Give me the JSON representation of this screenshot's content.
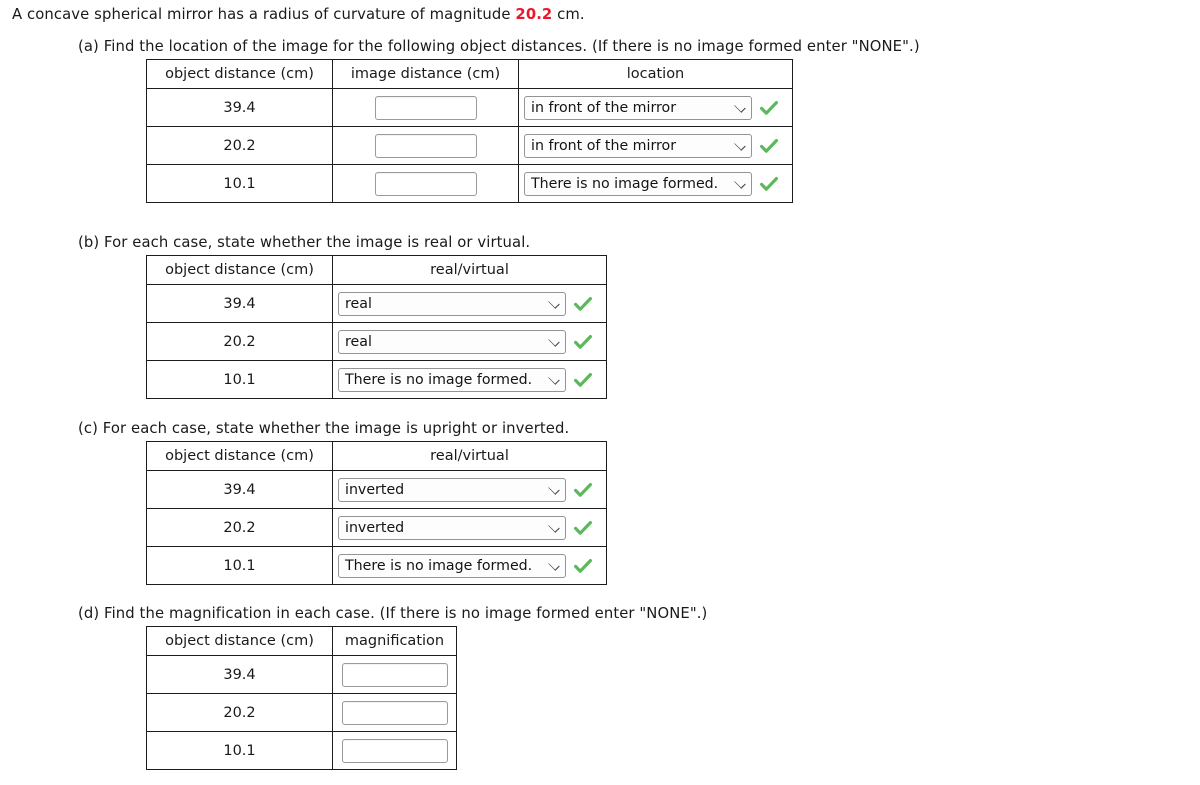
{
  "problem": {
    "statement_before": "A concave spherical mirror has a radius of curvature of magnitude ",
    "radius_value": "20.2",
    "statement_after": " cm."
  },
  "colors": {
    "value_red": "#e8192c",
    "check_green": "#5cb85c",
    "table_border": "#1c1c1c"
  },
  "parts": {
    "a": {
      "prompt": "(a) Find the location of the image for the following object distances. (If there is no image formed enter \"NONE\".)",
      "headers": [
        "object distance (cm)",
        "image distance (cm)",
        "location"
      ],
      "rows": [
        {
          "object_distance": "39.4",
          "image_distance": "",
          "location": "in front of the mirror",
          "correct": "correct-check"
        },
        {
          "object_distance": "20.2",
          "image_distance": "",
          "location": "in front of the mirror",
          "correct": "correct-check"
        },
        {
          "object_distance": "10.1",
          "image_distance": "",
          "location": "There is no image formed.",
          "correct": "correct-check"
        }
      ]
    },
    "b": {
      "prompt": "(b) For each case, state whether the image is real or virtual.",
      "headers": [
        "object distance (cm)",
        "real/virtual"
      ],
      "rows": [
        {
          "object_distance": "39.4",
          "answer": "real",
          "correct": "correct-check"
        },
        {
          "object_distance": "20.2",
          "answer": "real",
          "correct": "correct-check"
        },
        {
          "object_distance": "10.1",
          "answer": "There is no image formed.",
          "correct": "correct-check"
        }
      ]
    },
    "c": {
      "prompt": "(c) For each case, state whether the image is upright or inverted.",
      "headers": [
        "object distance (cm)",
        "real/virtual"
      ],
      "rows": [
        {
          "object_distance": "39.4",
          "answer": "inverted",
          "correct": "correct-check"
        },
        {
          "object_distance": "20.2",
          "answer": "inverted",
          "correct": "correct-check"
        },
        {
          "object_distance": "10.1",
          "answer": "There is no image formed.",
          "correct": "correct-check"
        }
      ]
    },
    "d": {
      "prompt": "(d) Find the magnification in each case. (If there is no image formed enter \"NONE\".)",
      "headers": [
        "object distance (cm)",
        "magnification"
      ],
      "rows": [
        {
          "object_distance": "39.4",
          "magnification": ""
        },
        {
          "object_distance": "20.2",
          "magnification": ""
        },
        {
          "object_distance": "10.1",
          "magnification": ""
        }
      ]
    }
  }
}
